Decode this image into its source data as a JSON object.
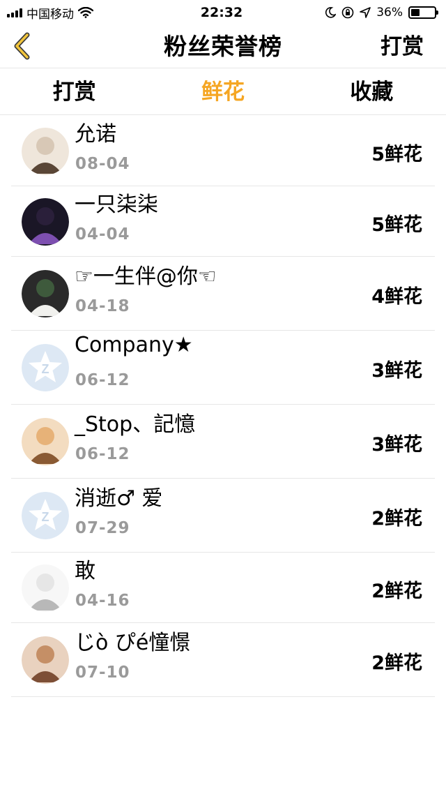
{
  "status": {
    "carrier": "中国移动",
    "time": "22:32",
    "battery": "36%",
    "battery_level": 0.36
  },
  "nav": {
    "title": "粉丝荣誉榜",
    "action": "打赏"
  },
  "tabs": [
    {
      "label": "打赏",
      "active": false
    },
    {
      "label": "鲜花",
      "active": true
    },
    {
      "label": "收藏",
      "active": false
    }
  ],
  "colors": {
    "accent": "#f5a623",
    "date": "#9a9a9a",
    "divider": "#e6e6e6"
  },
  "fans": [
    {
      "name": "允诺",
      "date": "08-04",
      "count": "5鲜花",
      "avatar": "photo"
    },
    {
      "name": "一只柒柒",
      "date": "04-04",
      "count": "5鲜花",
      "avatar": "photo"
    },
    {
      "name": "☞一生伴@你☜",
      "date": "04-18",
      "count": "4鲜花",
      "avatar": "photo"
    },
    {
      "name": "Company★",
      "date": "06-12",
      "count": "3鲜花",
      "avatar": "default"
    },
    {
      "name": "_Stop、記憶",
      "date": "06-12",
      "count": "3鲜花",
      "avatar": "photo"
    },
    {
      "name": "消逝♂ 爱",
      "date": "07-29",
      "count": "2鲜花",
      "avatar": "default"
    },
    {
      "name": "敢",
      "date": "04-16",
      "count": "2鲜花",
      "avatar": "photo"
    },
    {
      "name": "じò ぴé憧憬",
      "date": "07-10",
      "count": "2鲜花",
      "avatar": "photo"
    }
  ]
}
